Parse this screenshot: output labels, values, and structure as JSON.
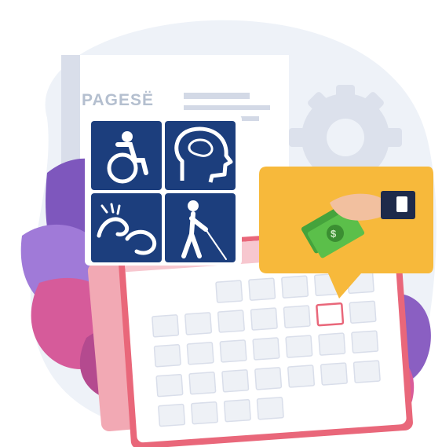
{
  "document": {
    "title": "PAGESË"
  },
  "icons": [
    "wheelchair-icon",
    "brain-icon",
    "sign-language-icon",
    "blind-cane-icon",
    "hand-money-icon"
  ],
  "calendar": {
    "highlighted_cell": {
      "row": 1,
      "col": 5
    }
  },
  "colors": {
    "background_blob": "#eef2f8",
    "tile_blue": "#1c3e7d",
    "callout_yellow": "#f7b93b",
    "calendar_red": "#e9677a",
    "foliage_purple": "#8a5fc2",
    "foliage_pink": "#d95b9a",
    "money_green": "#45a33c"
  }
}
